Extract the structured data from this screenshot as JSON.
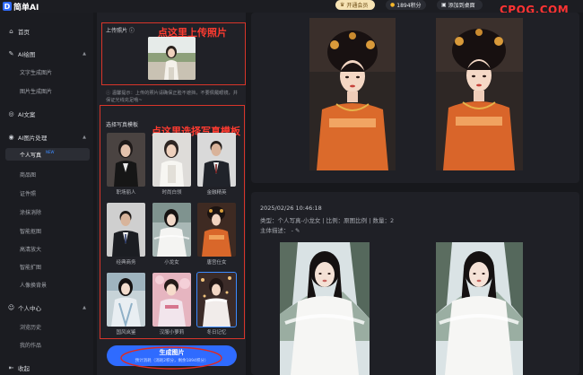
{
  "app": {
    "logo_mark": "D",
    "name": "简单AI"
  },
  "topbar": {
    "vip_label": "开通会员",
    "credits_label": "1894积分",
    "desktop_label": "添加到桌面",
    "watermark": "CPQG.COM"
  },
  "sidebar": {
    "items": [
      {
        "label": "首页",
        "icon": "home-icon"
      },
      {
        "label": "AI绘图",
        "icon": "paint-icon"
      },
      {
        "label": "文字生成图片"
      },
      {
        "label": "图片生成图片"
      },
      {
        "label": "AI文案",
        "icon": "ai-text-icon"
      },
      {
        "label": "AI图片处理",
        "icon": "image-process-icon"
      },
      {
        "label": "个人写真",
        "badge": "NEW"
      },
      {
        "label": "商品图"
      },
      {
        "label": "证件照"
      },
      {
        "label": "涂抹消除"
      },
      {
        "label": "智能抠图"
      },
      {
        "label": "高清放大"
      },
      {
        "label": "智能扩图"
      },
      {
        "label": "人像换背景"
      },
      {
        "label": "个人中心",
        "icon": "user-icon"
      },
      {
        "label": "浏览历史"
      },
      {
        "label": "我的作品"
      },
      {
        "label": "收起",
        "icon": "collapse-icon"
      }
    ]
  },
  "upload": {
    "label": "上传照片 ⓘ",
    "annotation": "点这里上传照片",
    "warning": "ⓘ 温馨提示：上传的照片请确保正脸不遮挡，不要佩戴眼镜，并保证光线充足哦~"
  },
  "templates": {
    "title": "选择写真模板",
    "annotation": "点这里选择写真模板",
    "items": [
      {
        "name": "职场丽人"
      },
      {
        "name": "时尚白领"
      },
      {
        "name": "金融精英"
      },
      {
        "name": "经典商务"
      },
      {
        "name": "小龙女"
      },
      {
        "name": "唐宫仕女"
      },
      {
        "name": "国风岚鉴"
      },
      {
        "name": "汉服小萝莉"
      },
      {
        "name": "冬日记忆"
      }
    ]
  },
  "generate": {
    "label": "生成图片",
    "sub": "预计消耗（消耗2积分，剩余1894积分）"
  },
  "results": {
    "date": "2025/02/26 10:46:18",
    "info": "类型：个人写真-小龙女 | 比例：原图比例 | 数量：2",
    "desc_label": "主体描述：",
    "desc_value": "- ✎"
  },
  "colors": {
    "accent": "#2f6bff",
    "annotation_red": "#ff3b30",
    "vip": "#f6e3b4"
  }
}
